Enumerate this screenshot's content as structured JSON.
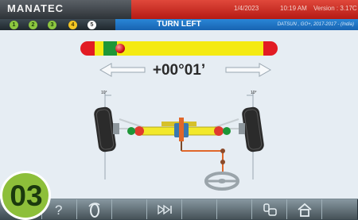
{
  "header": {
    "brand": "MANATEC",
    "date": "1/4/2023",
    "time": "10:19 AM",
    "version": "Version : 3.17C"
  },
  "steps": [
    {
      "label": "1",
      "state": "done"
    },
    {
      "label": "2",
      "state": "done"
    },
    {
      "label": "3",
      "state": "done"
    },
    {
      "label": "4",
      "state": "active"
    },
    {
      "label": "5",
      "state": "pending"
    }
  ],
  "titlebar": {
    "title": "TURN LEFT",
    "vehicle": "DATSUN , GO+, 2017-2017 - (India)"
  },
  "gauge": {
    "indicator_fraction": 0.2
  },
  "reading": "+00°01’",
  "diagram": {
    "left_angle_label": "10°",
    "right_angle_label": "10°"
  },
  "toolbar": {
    "buttons": [
      "help-icon",
      "wheel-rotate-icon",
      "empty",
      "empty",
      "skip-forward-icon",
      "empty",
      "empty",
      "wheel-vehicle-icon",
      "home-icon",
      "empty"
    ]
  },
  "step_badge": "03",
  "colors": {
    "header_red": "#c8261e",
    "title_blue": "#1f74c8",
    "gauge_red": "#e21b23",
    "gauge_yellow": "#f4ea12",
    "gauge_green": "#1e9637",
    "step_done": "#8cc63f",
    "step_active": "#f3c623",
    "badge_green": "#8dbf3a"
  }
}
